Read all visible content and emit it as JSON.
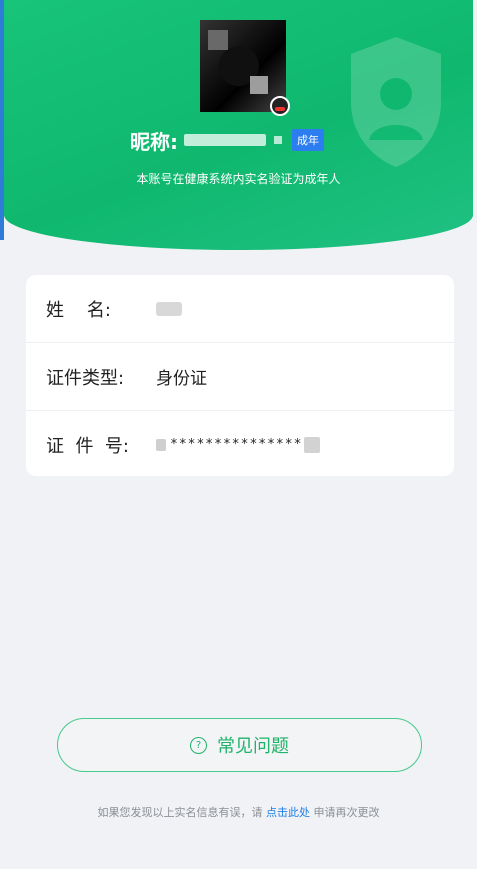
{
  "header": {
    "nickname_label": "昵称:",
    "adult_badge": "成年",
    "verify_text": "本账号在健康系统内实名验证为成年人"
  },
  "info": {
    "name_label": "姓    名:",
    "id_type_label": "证件类型:",
    "id_type_value": "身份证",
    "id_number_label": "证  件  号:",
    "id_number_masked": "***************"
  },
  "faq": {
    "icon": "question-circle-icon",
    "label": "常见问题"
  },
  "footer": {
    "prefix": "如果您发现以上实名信息有误，请",
    "link": "点击此处",
    "suffix": "申请再次更改"
  },
  "colors": {
    "primary_green": "#18c47a",
    "badge_blue": "#2b7df0",
    "link_blue": "#1e7ee6"
  }
}
